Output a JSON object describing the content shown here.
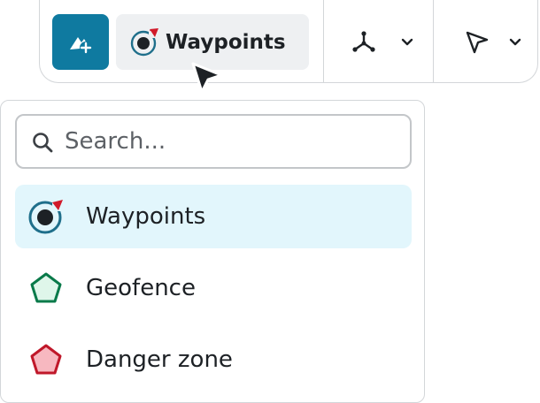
{
  "toolbar": {
    "add_button_icon": "add-mission-icon",
    "mode_button_label": "Waypoints",
    "mode_button_icon": "waypoints-icon",
    "tool_1_icon": "tri-axis-icon",
    "tool_1_chevron": "chevron-down-icon",
    "tool_2_icon": "pointer-icon",
    "tool_2_chevron": "chevron-down-icon"
  },
  "dropdown": {
    "search": {
      "placeholder": "Search...",
      "value": ""
    },
    "items": [
      {
        "label": "Waypoints",
        "icon": "waypoints-icon",
        "selected": true
      },
      {
        "label": "Geofence",
        "icon": "geofence-pentagon-icon",
        "selected": false
      },
      {
        "label": "Danger zone",
        "icon": "danger-zone-pentagon-icon",
        "selected": false
      }
    ]
  },
  "colors": {
    "accent": "#0f7aa0",
    "selected_bg": "#e2f6fc",
    "waypoint_ring": "#1f6f8b",
    "waypoint_marker": "#d11a2a",
    "geofence_stroke": "#0a7a4a",
    "geofence_fill": "#dff6ea",
    "danger_stroke": "#c0182a",
    "danger_fill": "#f7b8c0"
  }
}
